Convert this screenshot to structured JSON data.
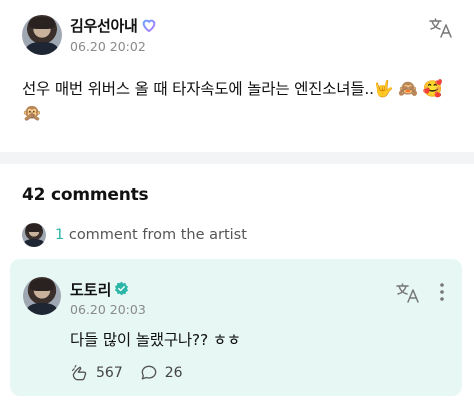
{
  "post": {
    "author": "김우선아내",
    "timestamp": "06.20 20:02",
    "text": "선우 매번 위버스 올 때 타자속도에 놀라는 엔진소녀들..",
    "emojis": [
      "🤟",
      "🙈",
      "🥰",
      "🙊"
    ],
    "heart_icon": "heart-icon",
    "translate_icon": "translate-icon"
  },
  "comments": {
    "title": "42 comments",
    "artist_count": "1",
    "artist_text": " comment from the artist"
  },
  "artist_comment": {
    "author": "도토리",
    "verified_icon": "verified-badge-icon",
    "timestamp": "06.20 20:03",
    "text": "다들 많이 놀랬구나?? ㅎㅎ",
    "likes": "567",
    "replies": "26"
  },
  "colors": {
    "accent": "#2bb6a8",
    "card_bg": "#e6f7f4",
    "divider": "#f3f4f6",
    "heart_gradient": [
      "#6aa0ff",
      "#b57cff"
    ]
  }
}
